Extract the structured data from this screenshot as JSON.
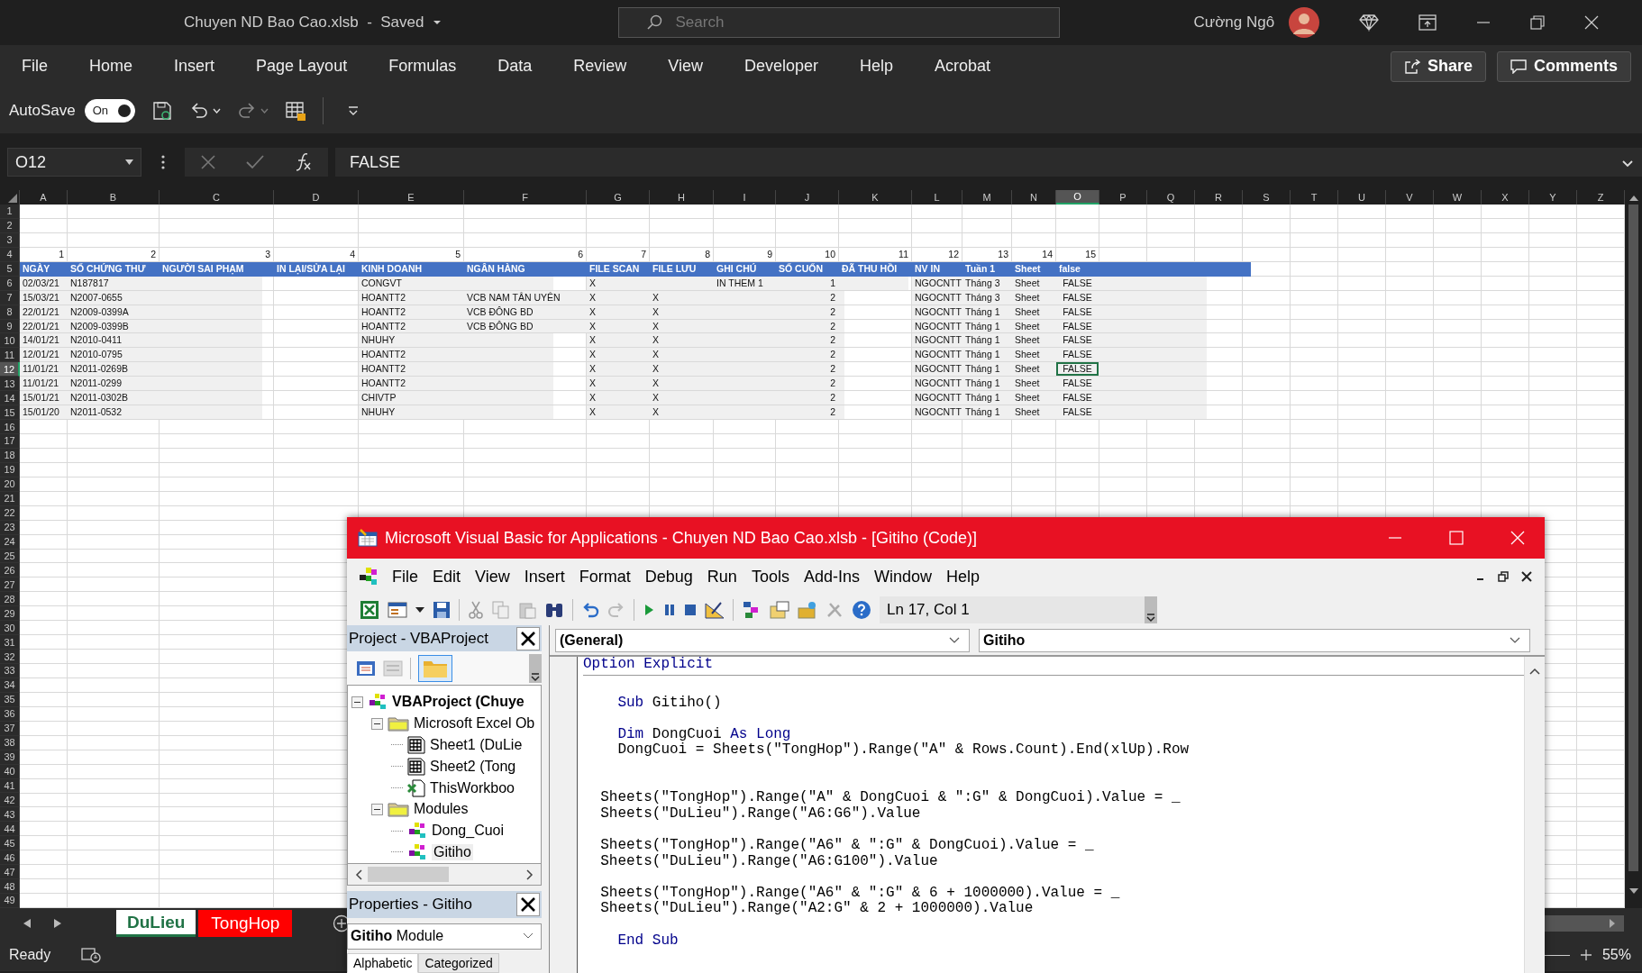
{
  "title_bar": {
    "document": "Chuyen ND Bao Cao.xlsb  -  Saved",
    "search_placeholder": "Search",
    "user": "Cường Ngô"
  },
  "ribbon_tabs": [
    "File",
    "Home",
    "Insert",
    "Page Layout",
    "Formulas",
    "Data",
    "Review",
    "View",
    "Developer",
    "Help",
    "Acrobat"
  ],
  "share": "Share",
  "comments": "Comments",
  "quick_access": {
    "autosave": "AutoSave",
    "toggle_label": "On",
    "on": true
  },
  "formula_bar": {
    "name_box": "O12",
    "formula": "FALSE"
  },
  "sheet": {
    "columns": [
      {
        "label": "A",
        "selected": false
      },
      {
        "label": "B",
        "selected": false
      },
      {
        "label": "C",
        "selected": false
      },
      {
        "label": "D",
        "selected": false
      },
      {
        "label": "E",
        "selected": false
      },
      {
        "label": "F",
        "selected": false
      },
      {
        "label": "G",
        "selected": false
      },
      {
        "label": "H",
        "selected": false
      },
      {
        "label": "I",
        "selected": false
      },
      {
        "label": "J",
        "selected": false
      },
      {
        "label": "K",
        "selected": false
      },
      {
        "label": "L",
        "selected": false
      },
      {
        "label": "M",
        "selected": false
      },
      {
        "label": "N",
        "selected": false
      },
      {
        "label": "O",
        "selected": true
      },
      {
        "label": "P",
        "selected": false
      },
      {
        "label": "Q",
        "selected": false
      },
      {
        "label": "R",
        "selected": false
      },
      {
        "label": "S",
        "selected": false
      },
      {
        "label": "T",
        "selected": false
      },
      {
        "label": "U",
        "selected": false
      },
      {
        "label": "V",
        "selected": false
      },
      {
        "label": "W",
        "selected": false
      },
      {
        "label": "X",
        "selected": false
      },
      {
        "label": "Y",
        "selected": false
      },
      {
        "label": "Z",
        "selected": false
      }
    ],
    "rows": [
      {
        "n": "1",
        "selected": false,
        "kind": "empty"
      },
      {
        "n": "2",
        "selected": false,
        "kind": "empty"
      },
      {
        "n": "3",
        "selected": false,
        "kind": "empty"
      },
      {
        "n": "4",
        "selected": false,
        "kind": "numbers",
        "cells": [
          "1",
          "2",
          "3",
          "4",
          "5",
          "6",
          "7",
          "8",
          "9",
          "10",
          "11",
          "12",
          "13",
          "14",
          "15"
        ]
      },
      {
        "n": "5",
        "selected": false,
        "kind": "header",
        "cells": [
          "NGÀY",
          "SỐ CHỨNG THƯ",
          "NGƯỜI SAI PHẠM",
          "IN LẠI/SỬA LẠI",
          "KINH DOANH",
          "NGÂN HÀNG",
          "FILE SCAN",
          "FILE LƯU",
          "GHI CHÚ",
          "SỐ CUỐN",
          "ĐÃ THU HỒI",
          "NV IN",
          "Tuần 1",
          "Sheet",
          "false"
        ]
      },
      {
        "n": "6",
        "selected": false,
        "kind": "data",
        "cells": [
          "02/03/21",
          "N187817",
          null,
          null,
          "CONGVT",
          null,
          "X",
          null,
          "IN THEM 1",
          "1",
          null,
          "NGOCNTT",
          "Tháng 3",
          "Sheet",
          "FALSE"
        ]
      },
      {
        "n": "7",
        "selected": false,
        "kind": "data",
        "cells": [
          "15/03/21",
          "N2007-0655",
          null,
          null,
          "HOANTT2",
          "VCB NAM TÂN UYÊN",
          "X",
          "X",
          null,
          "2",
          null,
          "NGOCNTT",
          "Tháng 3",
          "Sheet",
          "FALSE"
        ]
      },
      {
        "n": "8",
        "selected": false,
        "kind": "data",
        "cells": [
          "22/01/21",
          "N2009-0399A",
          null,
          null,
          "HOANTT2",
          "VCB ĐÔNG BD",
          "X",
          "X",
          null,
          "2",
          null,
          "NGOCNTT",
          "Tháng 1",
          "Sheet",
          "FALSE"
        ]
      },
      {
        "n": "9",
        "selected": false,
        "kind": "data",
        "cells": [
          "22/01/21",
          "N2009-0399B",
          null,
          null,
          "HOANTT2",
          "VCB ĐÔNG BD",
          "X",
          "X",
          null,
          "2",
          null,
          "NGOCNTT",
          "Tháng 1",
          "Sheet",
          "FALSE"
        ]
      },
      {
        "n": "10",
        "selected": false,
        "kind": "data",
        "cells": [
          "14/01/21",
          "N2010-0411",
          null,
          null,
          "NHUHY",
          null,
          "X",
          "X",
          null,
          "2",
          null,
          "NGOCNTT",
          "Tháng 1",
          "Sheet",
          "FALSE"
        ]
      },
      {
        "n": "11",
        "selected": false,
        "kind": "data",
        "cells": [
          "12/01/21",
          "N2010-0795",
          null,
          null,
          "HOANTT2",
          null,
          "X",
          "X",
          null,
          "2",
          null,
          "NGOCNTT",
          "Tháng 1",
          "Sheet",
          "FALSE"
        ]
      },
      {
        "n": "12",
        "selected": true,
        "kind": "data",
        "cells": [
          "11/01/21",
          "N2011-0269B",
          null,
          null,
          "HOANTT2",
          null,
          "X",
          "X",
          null,
          "2",
          null,
          "NGOCNTT",
          "Tháng 1",
          "Sheet",
          "FALSE"
        ]
      },
      {
        "n": "13",
        "selected": false,
        "kind": "data",
        "cells": [
          "11/01/21",
          "N2011-0299",
          null,
          null,
          "HOANTT2",
          null,
          "X",
          "X",
          null,
          "2",
          null,
          "NGOCNTT",
          "Tháng 1",
          "Sheet",
          "FALSE"
        ]
      },
      {
        "n": "14",
        "selected": false,
        "kind": "data",
        "cells": [
          "15/01/21",
          "N2011-0302B",
          null,
          null,
          "CHIVTP",
          null,
          "X",
          "X",
          null,
          "2",
          null,
          "NGOCNTT",
          "Tháng 1",
          "Sheet",
          "FALSE"
        ]
      },
      {
        "n": "15",
        "selected": false,
        "kind": "data",
        "cells": [
          "15/01/20",
          "N2011-0532",
          null,
          null,
          "NHUHY",
          null,
          "X",
          "X",
          null,
          "2",
          null,
          "NGOCNTT",
          "Tháng 1",
          "Sheet",
          "FALSE"
        ]
      },
      {
        "n": "16",
        "selected": false,
        "kind": "empty"
      },
      {
        "n": "17",
        "selected": false,
        "kind": "empty"
      },
      {
        "n": "18",
        "selected": false,
        "kind": "empty"
      },
      {
        "n": "19",
        "selected": false,
        "kind": "empty"
      },
      {
        "n": "20",
        "selected": false,
        "kind": "empty"
      },
      {
        "n": "21",
        "selected": false,
        "kind": "empty"
      },
      {
        "n": "22",
        "selected": false,
        "kind": "empty"
      },
      {
        "n": "23",
        "selected": false,
        "kind": "empty"
      },
      {
        "n": "24",
        "selected": false,
        "kind": "empty"
      },
      {
        "n": "25",
        "selected": false,
        "kind": "empty"
      },
      {
        "n": "26",
        "selected": false,
        "kind": "empty"
      },
      {
        "n": "27",
        "selected": false,
        "kind": "empty"
      },
      {
        "n": "28",
        "selected": false,
        "kind": "empty"
      },
      {
        "n": "29",
        "selected": false,
        "kind": "empty"
      },
      {
        "n": "30",
        "selected": false,
        "kind": "empty"
      },
      {
        "n": "31",
        "selected": false,
        "kind": "empty"
      },
      {
        "n": "32",
        "selected": false,
        "kind": "empty"
      },
      {
        "n": "33",
        "selected": false,
        "kind": "empty"
      },
      {
        "n": "34",
        "selected": false,
        "kind": "empty"
      },
      {
        "n": "35",
        "selected": false,
        "kind": "empty"
      },
      {
        "n": "36",
        "selected": false,
        "kind": "empty"
      },
      {
        "n": "37",
        "selected": false,
        "kind": "empty"
      },
      {
        "n": "38",
        "selected": false,
        "kind": "empty"
      },
      {
        "n": "39",
        "selected": false,
        "kind": "empty"
      },
      {
        "n": "40",
        "selected": false,
        "kind": "empty"
      },
      {
        "n": "41",
        "selected": false,
        "kind": "empty"
      },
      {
        "n": "42",
        "selected": false,
        "kind": "empty"
      },
      {
        "n": "43",
        "selected": false,
        "kind": "empty"
      },
      {
        "n": "44",
        "selected": false,
        "kind": "empty"
      },
      {
        "n": "45",
        "selected": false,
        "kind": "empty"
      },
      {
        "n": "46",
        "selected": false,
        "kind": "empty"
      },
      {
        "n": "47",
        "selected": false,
        "kind": "empty"
      },
      {
        "n": "48",
        "selected": false,
        "kind": "empty"
      },
      {
        "n": "49",
        "selected": false,
        "kind": "empty"
      }
    ]
  },
  "sheet_tabs": [
    {
      "label": "DuLieu",
      "selected": true
    },
    {
      "label": "TongHop",
      "selected": false,
      "color": "#ff0000"
    }
  ],
  "status_bar": {
    "status": "Ready",
    "zoom": "55%"
  },
  "vba": {
    "title": "Microsoft Visual Basic for Applications - Chuyen ND Bao Cao.xlsb - [Gitiho (Code)]",
    "menu": [
      "File",
      "Edit",
      "View",
      "Insert",
      "Format",
      "Debug",
      "Run",
      "Tools",
      "Add-Ins",
      "Window",
      "Help"
    ],
    "position": "Ln 17, Col 1",
    "project": {
      "title": "Project - VBAProject",
      "tree": [
        {
          "label": "VBAProject (Chuye",
          "kind": "project",
          "expanded": true,
          "selected": false,
          "children": [
            {
              "label": "Microsoft Excel Ob",
              "kind": "folder",
              "expanded": true,
              "selected": false,
              "children": [
                {
                  "label": "Sheet1 (DuLie",
                  "kind": "sheet",
                  "selected": false
                },
                {
                  "label": "Sheet2 (Tong",
                  "kind": "sheet",
                  "selected": false
                },
                {
                  "label": "ThisWorkboo",
                  "kind": "workbook",
                  "selected": false
                }
              ]
            },
            {
              "label": "Modules",
              "kind": "folder",
              "expanded": true,
              "selected": false,
              "children": [
                {
                  "label": "Dong_Cuoi",
                  "kind": "module",
                  "selected": false
                },
                {
                  "label": "Gitiho",
                  "kind": "module",
                  "selected": true
                }
              ]
            }
          ]
        }
      ]
    },
    "properties": {
      "title": "Properties - Gitiho",
      "object": "**Gitiho** Module",
      "tabs": [
        {
          "label": "Alphabetic",
          "selected": true
        },
        {
          "label": "Categorized",
          "selected": false
        }
      ]
    },
    "code": {
      "object": "(General)",
      "procedure": "Gitiho",
      "lines": [
        {
          "kind": "code",
          "separator": true,
          "parts": [
            {
              "text": "Option Explicit",
              "keyword": true
            }
          ]
        },
        {
          "kind": "blank"
        },
        {
          "kind": "code",
          "parts": [
            {
              "text": "    Sub",
              "keyword": true
            },
            {
              "text": " Gitiho()"
            }
          ]
        },
        {
          "kind": "blank"
        },
        {
          "kind": "code",
          "parts": [
            {
              "text": "    Dim",
              "keyword": true
            },
            {
              "text": " DongCuoi "
            },
            {
              "text": "As",
              "keyword": true
            },
            {
              "text": " Long",
              "keyword": true
            }
          ]
        },
        {
          "kind": "code",
          "parts": [
            {
              "text": "    DongCuoi = Sheets(\"TongHop\").Range(\"A\" & Rows.Count).End(xlUp).Row"
            }
          ]
        },
        {
          "kind": "blank"
        },
        {
          "kind": "blank"
        },
        {
          "kind": "code",
          "parts": [
            {
              "text": "  Sheets(\"TongHop\").Range(\"A\" & DongCuoi & \":G\" & DongCuoi).Value = _"
            }
          ]
        },
        {
          "kind": "code",
          "parts": [
            {
              "text": "  Sheets(\"DuLieu\").Range(\"A6:G6\").Value"
            }
          ]
        },
        {
          "kind": "blank"
        },
        {
          "kind": "code",
          "parts": [
            {
              "text": "  Sheets(\"TongHop\").Range(\"A6\" & \":G\" & DongCuoi).Value = _"
            }
          ]
        },
        {
          "kind": "code",
          "parts": [
            {
              "text": "  Sheets(\"DuLieu\").Range(\"A6:G100\").Value"
            }
          ]
        },
        {
          "kind": "blank"
        },
        {
          "kind": "code",
          "parts": [
            {
              "text": "  Sheets(\"TongHop\").Range(\"A6\" & \":G\" & 6 + 1000000).Value = _"
            }
          ]
        },
        {
          "kind": "code",
          "parts": [
            {
              "text": "  Sheets(\"DuLieu\").Range(\"A2:G\" & 2 + 1000000).Value"
            }
          ]
        },
        {
          "kind": "blank"
        },
        {
          "kind": "code",
          "parts": [
            {
              "text": "    End Sub",
              "keyword": true
            }
          ]
        }
      ]
    }
  }
}
